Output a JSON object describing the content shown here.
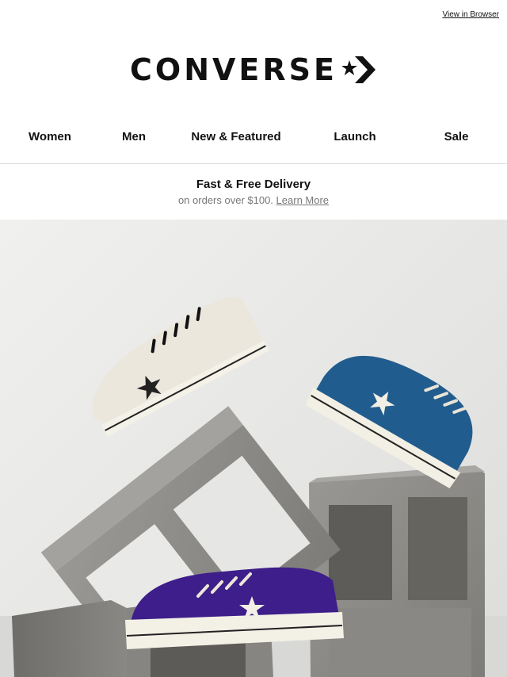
{
  "header": {
    "view_in_browser": "View in Browser",
    "brand": "CONVERSE"
  },
  "nav": {
    "items": [
      {
        "label": "Women"
      },
      {
        "label": "Men"
      },
      {
        "label": "New & Featured"
      },
      {
        "label": "Launch"
      },
      {
        "label": "Sale"
      }
    ]
  },
  "promo": {
    "title": "Fast & Free Delivery",
    "subtitle": "on orders over $100.",
    "link": "Learn More"
  },
  "hero": {
    "image": "three-one-star-sneakers-on-cinder-blocks",
    "colors": {
      "cream_shoe": "#e8e4da",
      "blue_shoe": "#1f5a8c",
      "purple_shoe": "#3f1f8c",
      "concrete": "#8e8c88"
    }
  }
}
